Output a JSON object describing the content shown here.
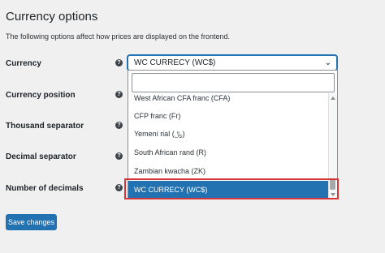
{
  "page": {
    "title": "Currency options",
    "description": "The following options affect how prices are displayed on the frontend."
  },
  "fields": {
    "currency": "Currency",
    "position": "Currency position",
    "thousand": "Thousand separator",
    "decimal": "Decimal separator",
    "decimals": "Number of decimals"
  },
  "help_glyph": "?",
  "select": {
    "value": "WC CURRECY (WC$)",
    "chevron": "⌄",
    "search_placeholder": ""
  },
  "options": [
    "West African CFA franc (CFA)",
    "CFP franc (Fr)",
    "Yemeni rial (﷼)",
    "South African rand (R)",
    "Zambian kwacha (ZK)",
    "WC CURRECY (WC$)"
  ],
  "selected_option": "WC CURRECY (WC$)",
  "buttons": {
    "save": "Save changes"
  },
  "colors": {
    "accent": "#2271b1",
    "highlight": "#d63638",
    "background": "#f0f0f1"
  }
}
